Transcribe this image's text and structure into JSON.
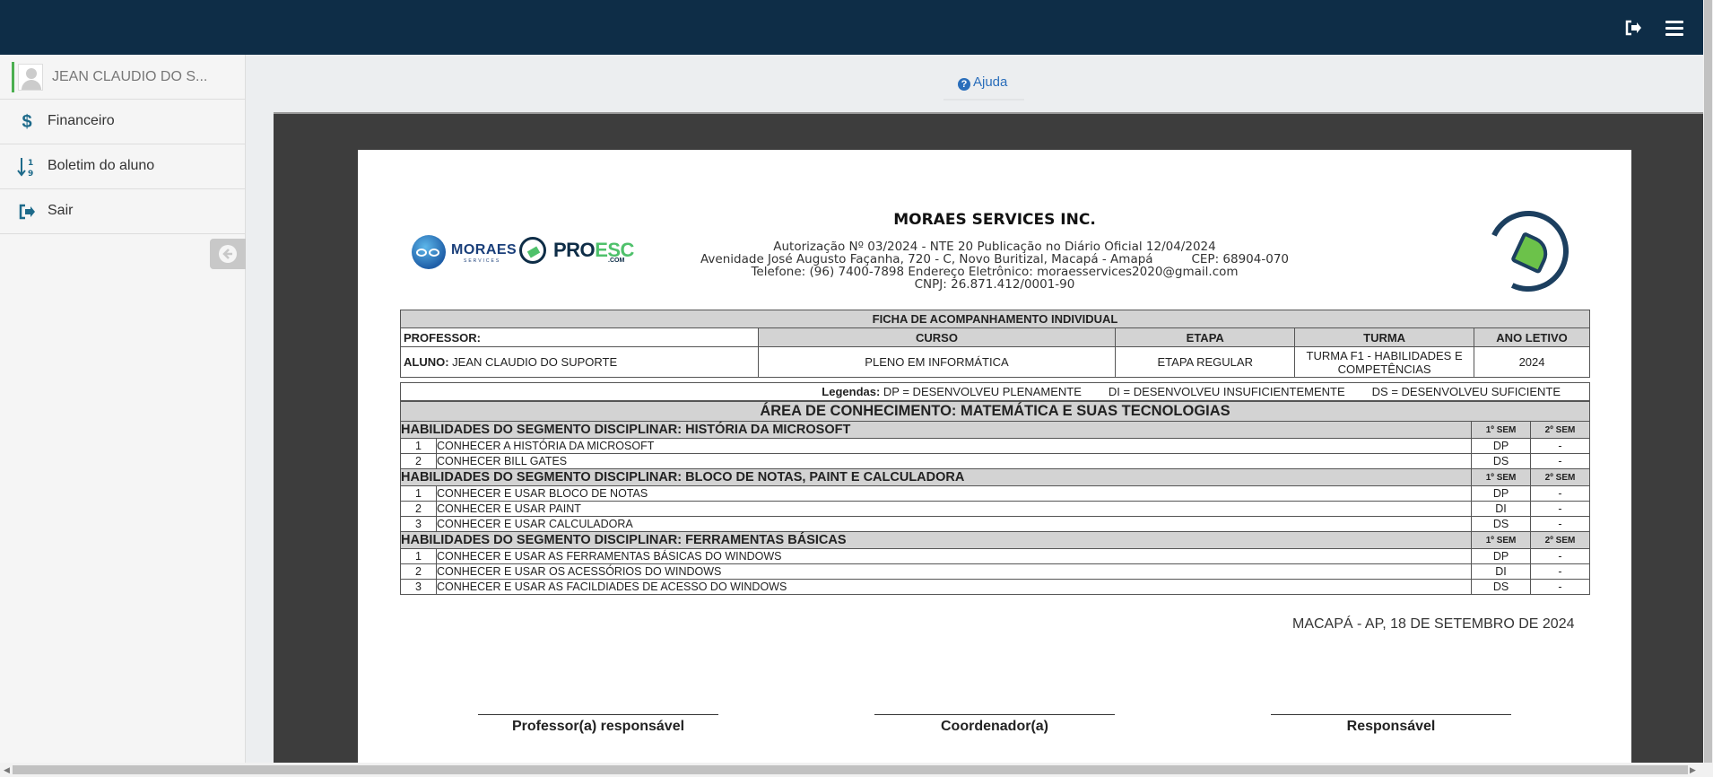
{
  "topbar": {
    "icons": [
      "logout-icon",
      "menu-icon"
    ],
    "color": "#0e2d47"
  },
  "sidebar": {
    "user_name": "JEAN CLAUDIO DO S...",
    "items": [
      {
        "label": "Financeiro",
        "icon": "dollar-icon"
      },
      {
        "label": "Boletim do aluno",
        "icon": "sort-numeric-icon"
      },
      {
        "label": "Sair",
        "icon": "sign-out-icon"
      }
    ]
  },
  "help": {
    "label": "Ajuda"
  },
  "document": {
    "logos": {
      "moraes": "MORAES",
      "moraes_sub": "SERVICES",
      "proesc_a": "PRO",
      "proesc_b": "ESC",
      "proesc_com": ".COM"
    },
    "company": "MORAES SERVICES INC.",
    "address_lines": [
      "Autorização Nº 03/2024 - NTE 20 Publicação no Diário Oficial 12/04/2024",
      "Avenidade José Augusto Façanha, 720 - C, Novo Buritizal, Macapá - Amapá          CEP: 68904-070",
      "Telefone: (96) 7400-7898 Endereço Eletrônico: moraesservices2020@gmail.com",
      "CNPJ: 26.871.412/0001-90"
    ],
    "form_title": "FICHA DE ACOMPANHAMENTO INDIVIDUAL",
    "professor_label": "PROFESSOR:",
    "headers": {
      "curso": "CURSO",
      "etapa": "ETAPA",
      "turma": "TURMA",
      "ano": "ANO LETIVO"
    },
    "aluno_label": "ALUNO:",
    "aluno_name": "JEAN CLAUDIO DO SUPORTE",
    "curso": "PLENO EM INFORMÁTICA",
    "etapa": "ETAPA REGULAR",
    "turma": "TURMA F1 - HABILIDADES E COMPETÊNCIAS",
    "ano": "2024",
    "legend": {
      "label": "Legendas:",
      "dp": "DP = DESENVOLVEU PLENAMENTE",
      "di": "DI = DESENVOLVEU INSUFICIENTEMENTE",
      "ds": "DS = DESENVOLVEU SUFICIENTE"
    },
    "area_title": "ÁREA DE CONHECIMENTO: MATEMÁTICA E SUAS TECNOLOGIAS",
    "sem1": "1º SEM",
    "sem2": "2º SEM",
    "segments": [
      {
        "title": "HABILIDADES DO SEGMENTO DISCIPLINAR: HISTÓRIA DA MICROSOFT",
        "skills": [
          {
            "n": "1",
            "text": "CONHECER A HISTÓRIA DA MICROSOFT",
            "s1": "DP",
            "s2": "-"
          },
          {
            "n": "2",
            "text": "CONHECER BILL GATES",
            "s1": "DS",
            "s2": "-"
          }
        ]
      },
      {
        "title": "HABILIDADES DO SEGMENTO DISCIPLINAR: BLOCO DE NOTAS, PAINT E CALCULADORA",
        "skills": [
          {
            "n": "1",
            "text": "CONHECER E USAR BLOCO DE NOTAS",
            "s1": "DP",
            "s2": "-"
          },
          {
            "n": "2",
            "text": "CONHECER E USAR PAINT",
            "s1": "DI",
            "s2": "-"
          },
          {
            "n": "3",
            "text": "CONHECER E USAR CALCULADORA",
            "s1": "DS",
            "s2": "-"
          }
        ]
      },
      {
        "title": "HABILIDADES DO SEGMENTO DISCIPLINAR: FERRAMENTAS BÁSICAS",
        "skills": [
          {
            "n": "1",
            "text": "CONHECER E USAR AS FERRAMENTAS BÁSICAS DO WINDOWS",
            "s1": "DP",
            "s2": "-"
          },
          {
            "n": "2",
            "text": "CONHECER E USAR OS ACESSÓRIOS DO WINDOWS",
            "s1": "DI",
            "s2": "-"
          },
          {
            "n": "3",
            "text": "CONHECER E USAR AS FACILDIADES DE ACESSO DO WINDOWS",
            "s1": "DS",
            "s2": "-"
          }
        ]
      }
    ],
    "date_line": "MACAPÁ - AP, 18 DE SETEMBRO DE 2024",
    "signatures": [
      "Professor(a) responsável",
      "Coordenador(a)",
      "Responsável"
    ]
  }
}
